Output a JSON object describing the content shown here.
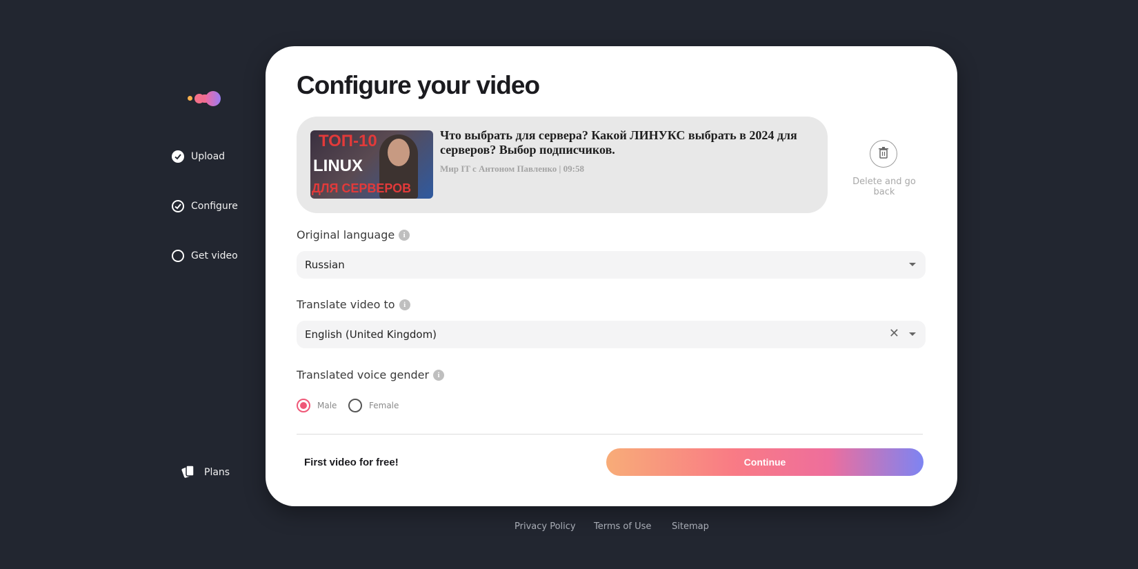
{
  "sidebar": {
    "steps": [
      {
        "label": "Upload",
        "state": "done"
      },
      {
        "label": "Configure",
        "state": "current"
      },
      {
        "label": "Get video",
        "state": "todo"
      }
    ],
    "plans_label": "Plans"
  },
  "main": {
    "title": "Configure your video",
    "video": {
      "thumbnail_text": [
        "ТОП-10",
        "LINUX",
        "ДЛЯ СЕРВЕРОВ"
      ],
      "title": "Что выбрать для сервера? Какой ЛИНУКС выбрать в 2024 для серверов? Выбор подписчиков.",
      "meta": "Мир IT с Антоном Павленко | 09:58"
    },
    "delete_label": "Delete and go back",
    "original_language": {
      "label": "Original language",
      "value": "Russian"
    },
    "translate_to": {
      "label": "Translate video to",
      "value": "English (United Kingdom)"
    },
    "voice_gender": {
      "label": "Translated voice gender",
      "options": [
        {
          "label": "Male",
          "selected": true
        },
        {
          "label": "Female",
          "selected": false
        }
      ]
    },
    "free_text": "First video for free!",
    "continue_label": "Continue"
  },
  "footer": {
    "links": [
      "Privacy Policy",
      "Terms of Use",
      "Sitemap"
    ]
  },
  "colors": {
    "background": "#222630",
    "accent": "#ef5777"
  }
}
